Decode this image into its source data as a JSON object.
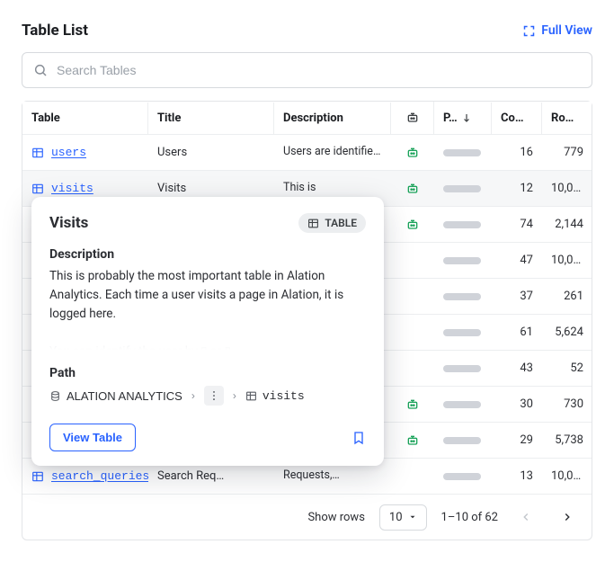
{
  "header": {
    "title": "Table List",
    "full_view": "Full View"
  },
  "search": {
    "placeholder": "Search Tables"
  },
  "columns": {
    "table": "Table",
    "title": "Title",
    "description": "Description",
    "popularity": "P…",
    "cols": "Co…",
    "rows": "Ro…"
  },
  "rows": [
    {
      "name": "users",
      "title": "Users",
      "desc": "Users are identified b…",
      "bot": true,
      "cols": "16",
      "rows": "779"
    },
    {
      "name": "visits",
      "title": "Visits",
      "desc": "This is",
      "bot": true,
      "cols": "12",
      "rows": "10,000",
      "highlight": true
    },
    {
      "name": "",
      "title": "",
      "desc": "",
      "bot": true,
      "cols": "74",
      "rows": "2,144"
    },
    {
      "name": "",
      "title": "",
      "desc": "",
      "bot": false,
      "cols": "47",
      "rows": "10,000"
    },
    {
      "name": "",
      "title": "",
      "desc": "",
      "bot": false,
      "cols": "37",
      "rows": "261"
    },
    {
      "name": "",
      "title": "",
      "desc": "",
      "bot": false,
      "cols": "61",
      "rows": "5,624"
    },
    {
      "name": "",
      "title": "",
      "desc": "",
      "bot": false,
      "cols": "43",
      "rows": "52"
    },
    {
      "name": "",
      "title": "",
      "desc": "",
      "bot": true,
      "cols": "30",
      "rows": "730"
    },
    {
      "name": "",
      "title": "",
      "desc": "",
      "bot": true,
      "cols": "29",
      "rows": "5,738"
    },
    {
      "name": "search_queries",
      "title": "Search Req…",
      "desc": "Requests,…",
      "bot": false,
      "cols": "13",
      "rows": "10,000"
    }
  ],
  "popover": {
    "title": "Visits",
    "chip": "TABLE",
    "desc_h": "Description",
    "desc": "This is probably the most important table in Alation Analytics. Each time a user visits a page in Alation, it is logged here.",
    "desc_more": "You can identify the user by ▯ or ▯",
    "path_h": "Path",
    "path_db": "ALATION ANALYTICS",
    "path_table": "visits",
    "view_btn": "View Table"
  },
  "footer": {
    "show_rows": "Show rows",
    "page_size": "10",
    "range": "1–10 of 62"
  }
}
